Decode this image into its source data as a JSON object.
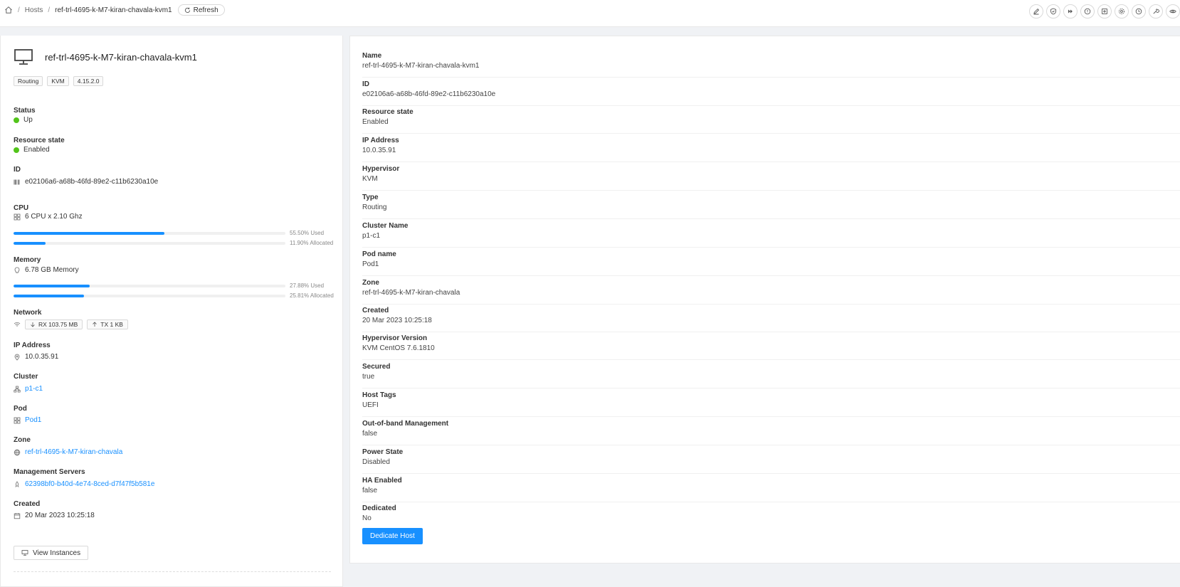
{
  "breadcrumb": {
    "hosts": "Hosts",
    "current": "ref-trl-4695-k-M7-kiran-chavala-kvm1",
    "refresh": "Refresh"
  },
  "toolbar_icons": [
    "edit-icon",
    "shield-icon",
    "forward-icon",
    "info-icon",
    "maintenance-icon",
    "settings-icon",
    "clock-icon",
    "wrench-icon",
    "eye-icon"
  ],
  "host": {
    "title": "ref-trl-4695-k-M7-kiran-chavala-kvm1",
    "tags": [
      "Routing",
      "KVM",
      "4.15.2.0"
    ],
    "status_label": "Status",
    "status": "Up",
    "resource_state_label": "Resource state",
    "resource_state": "Enabled",
    "id_label": "ID",
    "id": "e02106a6-a68b-46fd-89e2-c11b6230a10e",
    "cpu_label": "CPU",
    "cpu": "6 CPU x 2.10 Ghz",
    "cpu_used": 55.5,
    "cpu_used_text": "55.50% Used",
    "cpu_alloc": 11.9,
    "cpu_alloc_text": "11.90% Allocated",
    "memory_label": "Memory",
    "memory": "6.78 GB Memory",
    "mem_used": 27.88,
    "mem_used_text": "27.88% Used",
    "mem_alloc": 25.81,
    "mem_alloc_text": "25.81% Allocated",
    "network_label": "Network",
    "rx": "RX 103.75 MB",
    "tx": "TX 1 KB",
    "ip_label": "IP Address",
    "ip": "10.0.35.91",
    "cluster_label": "Cluster",
    "cluster": "p1-c1",
    "pod_label": "Pod",
    "pod": "Pod1",
    "zone_label": "Zone",
    "zone": "ref-trl-4695-k-M7-kiran-chavala",
    "mgmt_label": "Management Servers",
    "mgmt": "62398bf0-b40d-4e74-8ced-d7f47f5b581e",
    "created_label": "Created",
    "created": "20 Mar 2023 10:25:18",
    "view_instances": "View Instances"
  },
  "details": [
    {
      "label": "Name",
      "value": "ref-trl-4695-k-M7-kiran-chavala-kvm1"
    },
    {
      "label": "ID",
      "value": "e02106a6-a68b-46fd-89e2-c11b6230a10e"
    },
    {
      "label": "Resource state",
      "value": "Enabled"
    },
    {
      "label": "IP Address",
      "value": "10.0.35.91"
    },
    {
      "label": "Hypervisor",
      "value": "KVM"
    },
    {
      "label": "Type",
      "value": "Routing"
    },
    {
      "label": "Cluster Name",
      "value": "p1-c1"
    },
    {
      "label": "Pod name",
      "value": "Pod1"
    },
    {
      "label": "Zone",
      "value": "ref-trl-4695-k-M7-kiran-chavala"
    },
    {
      "label": "Created",
      "value": "20 Mar 2023 10:25:18"
    },
    {
      "label": "Hypervisor Version",
      "value": "KVM CentOS 7.6.1810"
    },
    {
      "label": "Secured",
      "value": "true"
    },
    {
      "label": "Host Tags",
      "value": "UEFI"
    },
    {
      "label": "Out-of-band Management",
      "value": "false"
    },
    {
      "label": "Power State",
      "value": "Disabled"
    },
    {
      "label": "HA Enabled",
      "value": "false"
    },
    {
      "label": "Dedicated",
      "value": "No"
    }
  ],
  "dedicate_button": "Dedicate Host"
}
